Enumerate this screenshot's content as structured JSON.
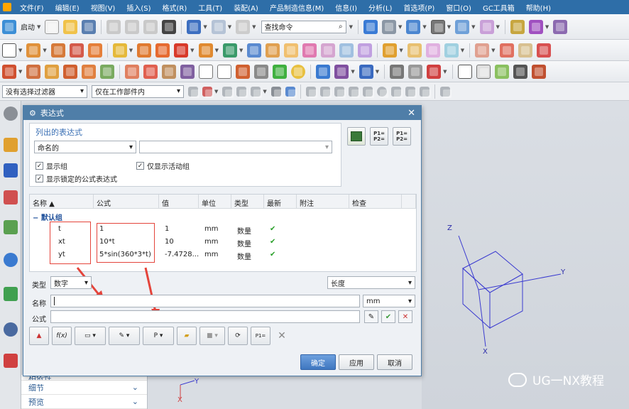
{
  "menubar": {
    "items": [
      "文件(F)",
      "编辑(E)",
      "视图(V)",
      "插入(S)",
      "格式(R)",
      "工具(T)",
      "装配(A)",
      "产品制造信息(M)",
      "信息(I)",
      "分析(L)",
      "首选项(P)",
      "窗口(O)",
      "GC工具箱",
      "帮助(H)"
    ]
  },
  "toolbar": {
    "start_label": "启动",
    "command_search_placeholder": "查找命令",
    "filter_select": "没有选择过滤器",
    "scope_select": "仅在工作部件内"
  },
  "dialog": {
    "title": "表达式",
    "list_group": {
      "title": "列出的表达式",
      "filter_value": "命名的",
      "search_value": "",
      "checkboxes": [
        {
          "label": "显示组",
          "checked": true
        },
        {
          "label": "仅显示活动组",
          "checked": true
        },
        {
          "label": "显示锁定的公式表达式",
          "checked": true
        }
      ]
    },
    "big_buttons": [
      "P1=\nP2=",
      "P1=\nP2="
    ],
    "table": {
      "columns": [
        "名称",
        "公式",
        "值",
        "单位",
        "类型",
        "最新",
        "附注",
        "检查"
      ],
      "group_name": "默认组",
      "rows": [
        {
          "name": "t",
          "formula": "1",
          "value": "1",
          "unit": "mm",
          "type": "数量",
          "uptodate": "✔"
        },
        {
          "name": "xt",
          "formula": "10*t",
          "value": "10",
          "unit": "mm",
          "type": "数量",
          "uptodate": "✔"
        },
        {
          "name": "yt",
          "formula": "5*sin(360*3*t)",
          "value": "-7.4728...",
          "unit": "mm",
          "type": "数量",
          "uptodate": "✔"
        }
      ]
    },
    "form": {
      "type_label": "类型",
      "type_value": "数字",
      "dimension_value": "长度",
      "name_label": "名称",
      "name_value": "",
      "unit_value": "mm",
      "formula_label": "公式",
      "formula_value": ""
    },
    "actions": {
      "ok": "确定",
      "apply": "应用",
      "cancel": "取消"
    }
  },
  "nav": {
    "items": [
      "相依性",
      "细节",
      "预览"
    ]
  },
  "viewport": {
    "axes": {
      "x": "X",
      "y": "Y",
      "z": "Z"
    },
    "small_axes": {
      "y": "Y",
      "x": "X"
    }
  },
  "watermark": {
    "text": "UG一NX教程"
  },
  "colors": {
    "menubar": "#2e6ea8",
    "dialog_title": "#4f7ea8",
    "annotation_red": "#e4443b",
    "axis_blue": "#2a2aa8"
  }
}
